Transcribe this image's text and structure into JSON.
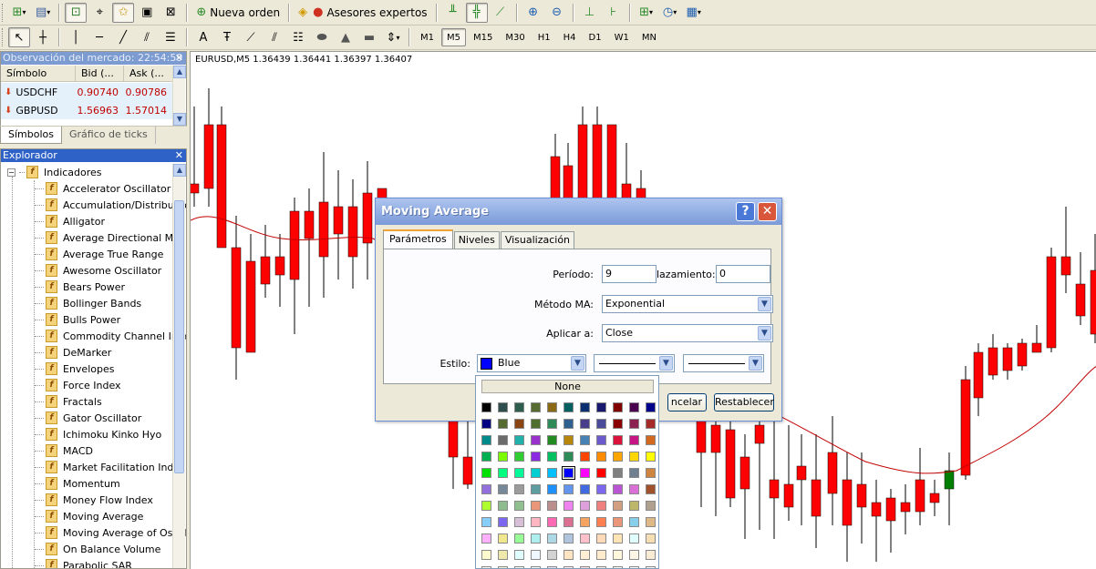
{
  "toolbar_main": {
    "new_order_label": "Nueva orden",
    "expert_advisors_label": "Asesores expertos"
  },
  "timeframes": [
    "M1",
    "M5",
    "M15",
    "M30",
    "H1",
    "H4",
    "D1",
    "W1",
    "MN"
  ],
  "active_timeframe": "M5",
  "market_watch": {
    "title": "Observación del mercado: 22:54:59",
    "columns": [
      "Símbolo",
      "Bid (...",
      "Ask (..."
    ],
    "rows": [
      {
        "symbol": "USDCHF",
        "bid": "0.90740",
        "ask": "0.90786"
      },
      {
        "symbol": "GBPUSD",
        "bid": "1.56963",
        "ask": "1.57014"
      }
    ],
    "tabs": [
      "Símbolos",
      "Gráfico de ticks"
    ]
  },
  "navigator": {
    "title": "Explorador",
    "root_label": "Indicadores",
    "items": [
      "Accelerator Oscillator",
      "Accumulation/Distribution",
      "Alligator",
      "Average Directional Movement Index",
      "Average True Range",
      "Awesome Oscillator",
      "Bears Power",
      "Bollinger Bands",
      "Bulls Power",
      "Commodity Channel Index",
      "DeMarker",
      "Envelopes",
      "Force Index",
      "Fractals",
      "Gator Oscillator",
      "Ichimoku Kinko Hyo",
      "MACD",
      "Market Facilitation Index",
      "Momentum",
      "Money Flow Index",
      "Moving Average",
      "Moving Average of Oscillator",
      "On Balance Volume",
      "Parabolic SAR"
    ]
  },
  "chart": {
    "header": "EURUSD,M5  1.36439 1.36441 1.36397 1.36407",
    "up_color": "#008000",
    "down_color": "#ff0000",
    "ma_color": "#c00000"
  },
  "dialog": {
    "title": "Moving Average",
    "tabs": [
      "Parámetros",
      "Niveles",
      "Visualización"
    ],
    "period_label": "Período:",
    "period_value": "9",
    "shift_label": "lazamiento:",
    "shift_value": "0",
    "ma_method_label": "Método MA:",
    "ma_method_value": "Exponential",
    "apply_to_label": "Aplicar a:",
    "apply_to_value": "Close",
    "style_label": "Estilo:",
    "style_color_value": "Blue",
    "cancel_label": "ncelar",
    "reset_label": "Restablecer"
  },
  "color_picker": {
    "none_label": "None",
    "selected_color": "#0000ff",
    "rows": [
      [
        "#000000",
        "#2f4f4f",
        "#2e5e4e",
        "#556b2f",
        "#8b6914",
        "#006060",
        "#0a2f6f",
        "#191970",
        "#800000",
        "#4b0050",
        "#00008b"
      ],
      [
        "#000080",
        "#556b2f",
        "#8b4513",
        "#4f6f2f",
        "#2e8b57",
        "#306090",
        "#483d8b",
        "#4b4b9b",
        "#8b0000",
        "#8b2252",
        "#a52a2a"
      ],
      [
        "#008b8b",
        "#6b6b6b",
        "#20b2aa",
        "#9932cc",
        "#228b22",
        "#b8860b",
        "#4682b4",
        "#6a5acd",
        "#dc143c",
        "#c71585",
        "#d2691e"
      ],
      [
        "#00b050",
        "#7cfc00",
        "#32cd32",
        "#8a2be2",
        "#00c060",
        "#2e8b57",
        "#ff4500",
        "#ff8c00",
        "#ffa500",
        "#ffd700",
        "#ffff00"
      ],
      [
        "#00e000",
        "#00ff7f",
        "#00fa9a",
        "#00ced1",
        "#00bfff",
        "#0000ff",
        "#ff00ff",
        "#ff0000",
        "#808080",
        "#708090",
        "#cd853f"
      ],
      [
        "#9370db",
        "#778899",
        "#9b9b9b",
        "#5f9ea0",
        "#1e90ff",
        "#6495ed",
        "#4169e1",
        "#7b68ee",
        "#ba55d3",
        "#da70d6",
        "#a0522d"
      ],
      [
        "#adff2f",
        "#8fbc8f",
        "#90c090",
        "#e9967a",
        "#bc8f8f",
        "#ee82ee",
        "#dda0dd",
        "#f08080",
        "#d2a080",
        "#bdb76b",
        "#b0a090"
      ],
      [
        "#87cefa",
        "#7b68ee",
        "#d8bfd8",
        "#ffb6c1",
        "#ff69b4",
        "#db7093",
        "#f4a460",
        "#ff7f50",
        "#e9967a",
        "#87ceeb",
        "#deb887"
      ],
      [
        "#ffb0ff",
        "#f0e68c",
        "#98fb98",
        "#afeeee",
        "#add8e6",
        "#b0c4de",
        "#ffc0cb",
        "#ffdab9",
        "#ffe4b5",
        "#e0ffff",
        "#f5deb3"
      ],
      [
        "#fffacd",
        "#eee8aa",
        "#e0ffff",
        "#f0f8ff",
        "#d3d3d3",
        "#ffe4c4",
        "#ffefd5",
        "#ffebcd",
        "#fff8dc",
        "#fdf5e6",
        "#faebd7"
      ],
      [
        "#fffaf0",
        "#f5f5dc",
        "#f0fff0",
        "#f5fffa",
        "#e6e6fa",
        "#fff0f5",
        "#ffe4e1",
        "#faf0e6",
        "#fffff0",
        "#ffffff",
        "#f8f8ff"
      ]
    ]
  }
}
